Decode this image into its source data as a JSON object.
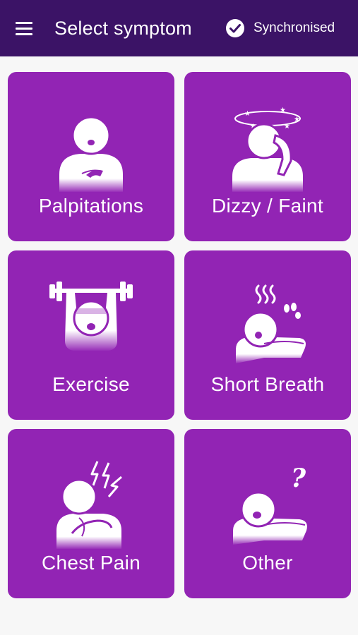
{
  "header": {
    "title": "Select symptom",
    "status_label": "Synchronised",
    "menu_icon": "hamburger-menu-icon",
    "status_icon": "check-circle-icon"
  },
  "symptoms": [
    {
      "label": "Palpitations",
      "icon": "palpitations-figure-icon"
    },
    {
      "label": "Dizzy / Faint",
      "icon": "dizzy-figure-icon"
    },
    {
      "label": "Exercise",
      "icon": "weightlifting-figure-icon"
    },
    {
      "label": "Short Breath",
      "icon": "short-breath-figure-icon"
    },
    {
      "label": "Chest Pain",
      "icon": "chest-pain-figure-icon"
    },
    {
      "label": "Other",
      "icon": "question-figure-icon"
    }
  ],
  "colors": {
    "appbar": "#3b1366",
    "tile": "#9224b4",
    "background": "#f7f7f7",
    "foreground": "#ffffff"
  }
}
